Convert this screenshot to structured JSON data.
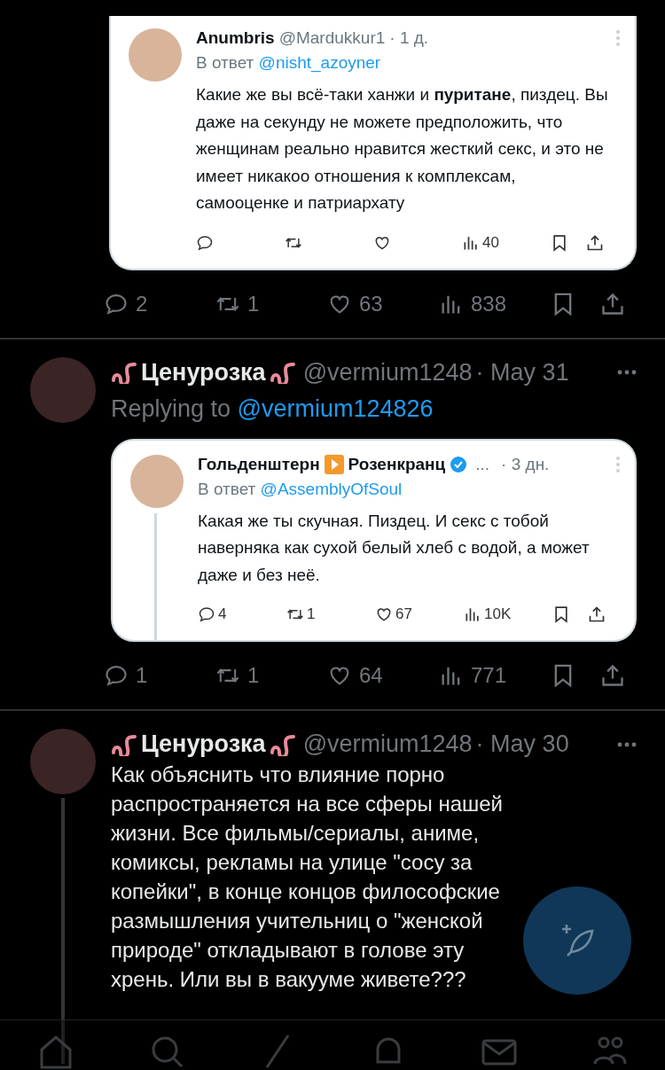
{
  "tweets": [
    {
      "kind": "cut",
      "embedded_card": {
        "name_parts": [
          "Anumbris"
        ],
        "handle": "@Mardukkur1",
        "date": "· 1 д.",
        "reply_label": "В ответ",
        "reply_to": "@nisht_azoyner",
        "text": "Какие же вы всё-таки ханжи и **пуритане**, пиздец. Вы даже на секунду не можете предположить, что женщинам реально нравится жесткий секс, и это не имеет никакоо отношения к комплексам, самооценке и патриархату",
        "actions": [
          {
            "kind": "reply"
          },
          {
            "kind": "retweet"
          },
          {
            "kind": "like"
          },
          {
            "kind": "views",
            "count": "40"
          },
          {
            "kind": "bookmark"
          },
          {
            "kind": "share"
          }
        ]
      },
      "actions": [
        {
          "kind": "reply",
          "count": "2"
        },
        {
          "kind": "retweet",
          "count": "1"
        },
        {
          "kind": "like",
          "count": "63"
        },
        {
          "kind": "views",
          "count": "838"
        },
        {
          "kind": "bookmark"
        },
        {
          "kind": "share"
        }
      ]
    },
    {
      "kind": "full",
      "author": "Ценурозка",
      "handle": "@vermium1248",
      "date": "· May 31",
      "replying_label": "Replying to",
      "replying_to": "@vermium124826",
      "embedded_card": {
        "name_parts": [
          "Гольденштерн",
          "Розенкранц"
        ],
        "verified": true,
        "truncation": "...",
        "date": "· 3 дн.",
        "reply_label": "В ответ",
        "reply_to": "@AssemblyOfSoul",
        "text": "Какая же ты скучная. Пиздец. И секс с тобой наверняка как сухой белый хлеб с водой, а может даже и без неё.",
        "thread_line": true,
        "actions": [
          {
            "kind": "reply",
            "count": "4"
          },
          {
            "kind": "retweet",
            "count": "1"
          },
          {
            "kind": "like",
            "count": "67"
          },
          {
            "kind": "views",
            "count": "10K"
          },
          {
            "kind": "bookmark"
          },
          {
            "kind": "share"
          }
        ]
      },
      "actions": [
        {
          "kind": "reply",
          "count": "1"
        },
        {
          "kind": "retweet",
          "count": "1"
        },
        {
          "kind": "like",
          "count": "64"
        },
        {
          "kind": "views",
          "count": "771"
        },
        {
          "kind": "bookmark"
        },
        {
          "kind": "share"
        }
      ]
    },
    {
      "kind": "full",
      "author": "Ценурозка",
      "handle": "@vermium1248",
      "date": "· May 30",
      "thread_line": true,
      "text": "Как объяснить что влияние порно распространяется на все сферы нашей жизни. Все фильмы/сериалы, аниме, комиксы, рекламы на улице \"сосу за копейки\", в конце концов философские размышления учительниц о \"женской природе\" откладывают в голове эту хрень. Или вы в вакууме живете???"
    }
  ]
}
